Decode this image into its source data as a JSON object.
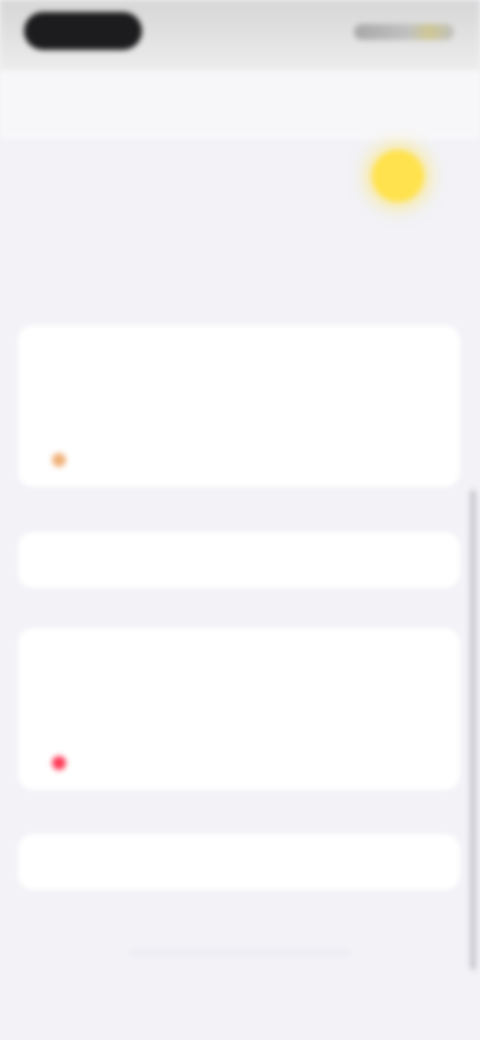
{
  "nav": {
    "title": "",
    "action_label": ""
  },
  "intro": {
    "text": "",
    "description": ""
  },
  "section": {
    "header": ""
  },
  "card_one": {
    "items": [
      {
        "label": ""
      },
      {
        "label": ""
      },
      {
        "label": ""
      }
    ]
  },
  "card_two": {
    "items": [
      {
        "label": ""
      }
    ]
  },
  "card_three": {
    "items": [
      {
        "label": ""
      },
      {
        "label": ""
      },
      {
        "label": ""
      }
    ]
  },
  "card_four": {
    "items": [
      {
        "label": ""
      }
    ]
  },
  "footer": {
    "text": ""
  },
  "colors": {
    "accent": "#1a73e8",
    "emoji_icon": "#ffe24d",
    "badge_orange": "#f0b27a",
    "badge_red": "#ff3b57",
    "background": "#f2f2f7"
  },
  "icons": {
    "top_right": "emoji-icon"
  }
}
